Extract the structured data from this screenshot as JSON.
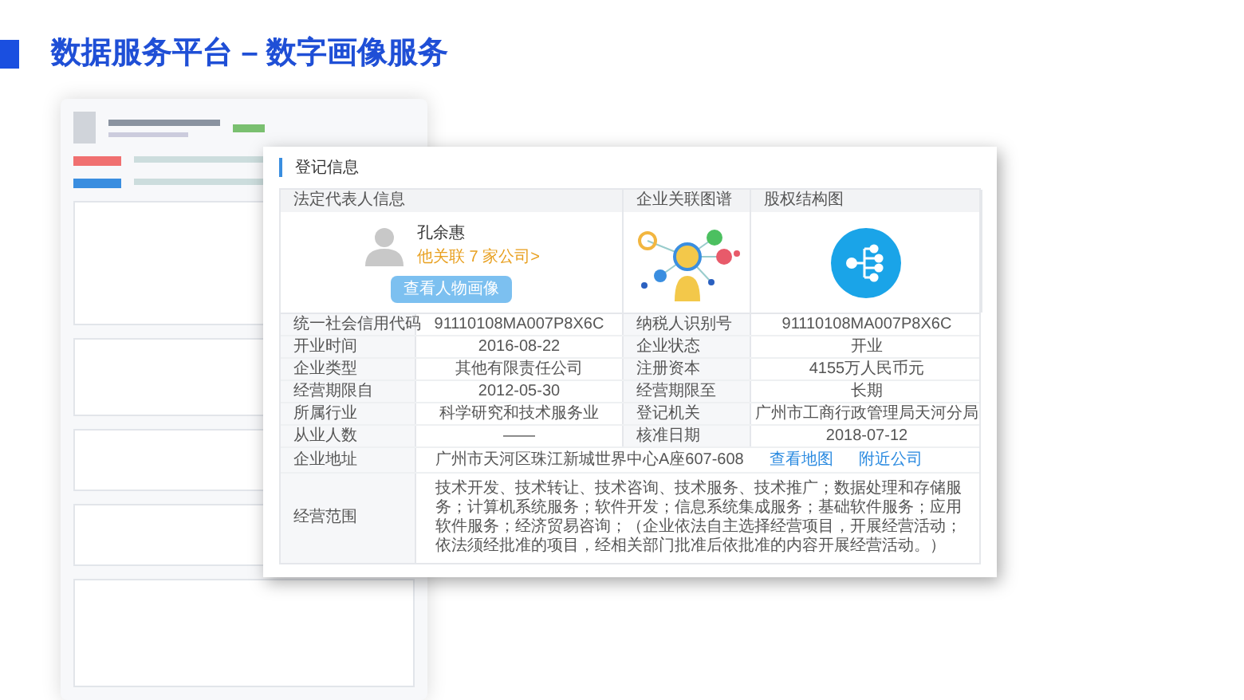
{
  "slide": {
    "title": "数据服务平台 – 数字画像服务"
  },
  "card": {
    "title": "登记信息",
    "panels": [
      {
        "kind": "person",
        "heading": "法定代表人信息",
        "name": "孔余惠",
        "link": "他关联 7 家公司>",
        "button": "查看人物画像"
      },
      {
        "kind": "graph",
        "heading": "企业关联图谱"
      },
      {
        "kind": "structure",
        "heading": "股权结构图"
      }
    ],
    "rows": [
      {
        "label": "统一社会信用代码",
        "value": "91110108MA007P8X6C",
        "label_2": "纳税人识别号",
        "value_2": "91110108MA007P8X6C"
      },
      {
        "label": "开业时间",
        "value": "2016-08-22",
        "label_2": "企业状态",
        "value_2": "开业"
      },
      {
        "label": "企业类型",
        "value": "其他有限责任公司",
        "label_2": "注册资本",
        "value_2": "4155万人民币元"
      },
      {
        "label": "经营期限自",
        "value": "2012-05-30",
        "label_2": "经营期限至",
        "value_2": "长期"
      },
      {
        "label": "所属行业",
        "value": "科学研究和技术服务业",
        "label_2": "登记机关",
        "value_2": "广州市工商行政管理局天河分局"
      },
      {
        "label": "从业人数",
        "value": "——",
        "label_2": "核准日期",
        "value_2": "2018-07-12"
      }
    ],
    "address": {
      "label": "企业地址",
      "value": "广州市天河区珠江新城世界中心A座607-608",
      "links": [
        "查看地图",
        "附近公司"
      ]
    },
    "scope": {
      "label": "经营范围",
      "value": "技术开发、技术转让、技术咨询、技术服务、技术推广；数据处理和存储服务；计算机系统服务；软件开发；信息系统集成服务；基础软件服务；应用软件服务；经济贸易咨询；（企业依法自主选择经营项目，开展经营活动；依法须经批准的项目，经相关部门批准后依批准的内容开展经营活动。）"
    }
  }
}
